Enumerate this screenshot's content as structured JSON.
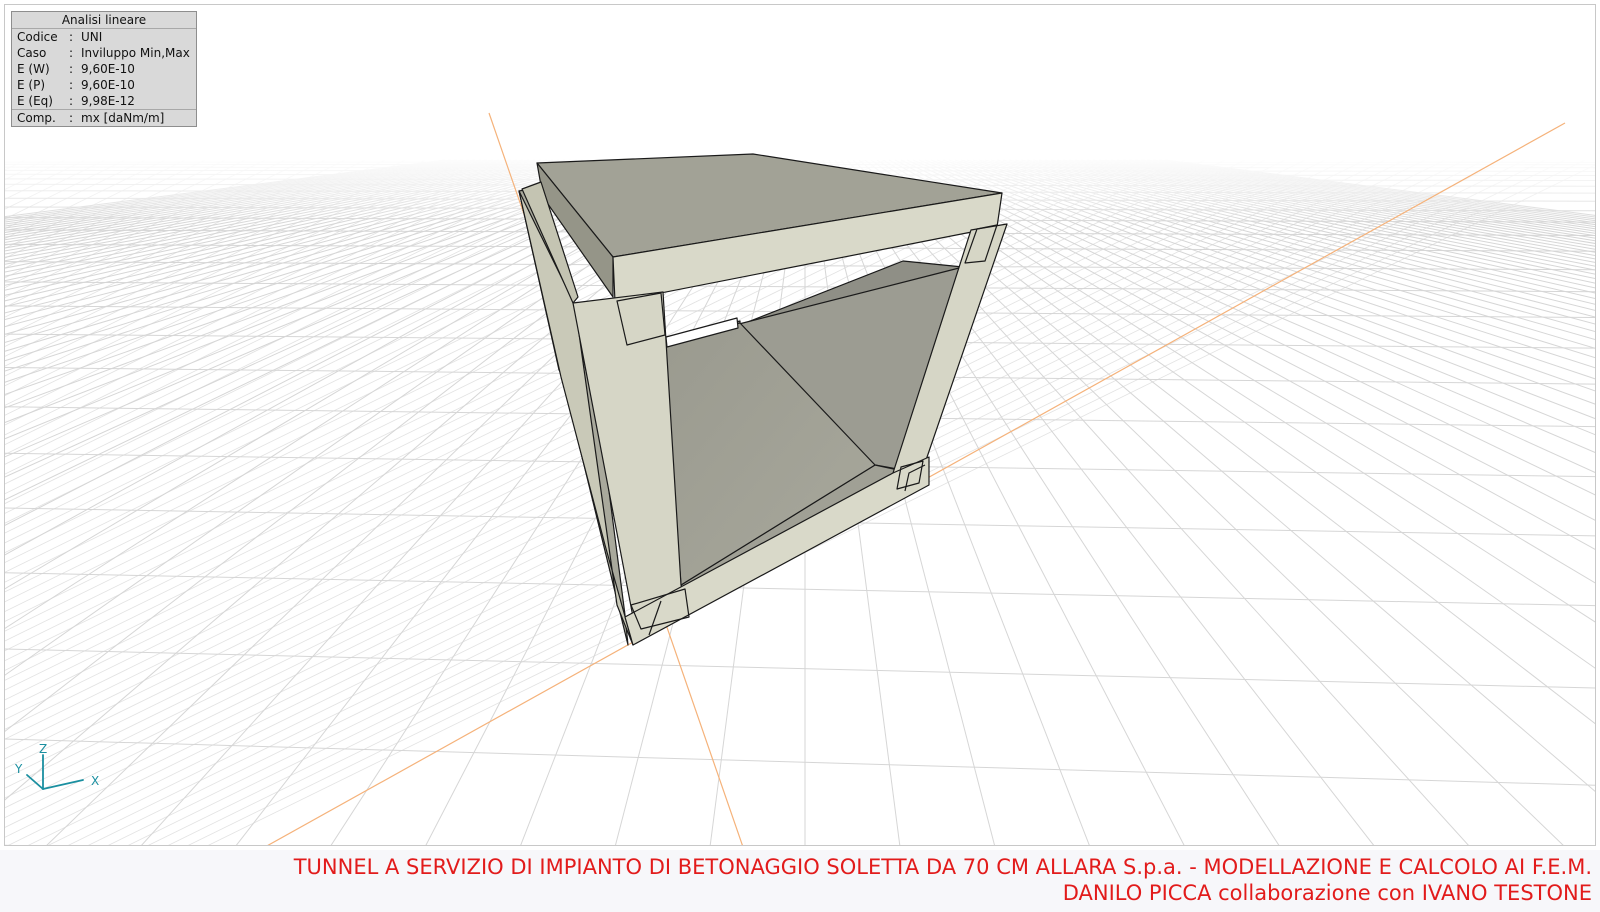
{
  "info_panel": {
    "title": "Analisi lineare",
    "rows": [
      {
        "key": "Codice",
        "value": "UNI"
      },
      {
        "key": "Caso",
        "value": "Inviluppo Min,Max"
      },
      {
        "key": "E (W)",
        "value": "9,60E-10"
      },
      {
        "key": "E (P)",
        "value": "9,60E-10"
      },
      {
        "key": "E (Eq)",
        "value": "9,98E-12"
      },
      {
        "key": "Comp.",
        "value": "mx [daNm/m]"
      }
    ]
  },
  "axes": {
    "z": "Z",
    "y": "Y",
    "x": "X"
  },
  "footer": {
    "line1": "TUNNEL A SERVIZIO DI IMPIANTO DI BETONAGGIO SOLETTA DA 70 CM ALLARA S.p.a. - MODELLAZIONE E CALCOLO AI F.E.M.",
    "line2": "DANILO PICCA collaborazione con IVANO TESTONE"
  },
  "colors": {
    "footer_text": "#e21b1b",
    "axis_triad": "#1a8fa0",
    "reference_axis": "#f5b27a",
    "grid": "#d6d6d6",
    "model_face_light": "#d8d8c8",
    "model_face_mid": "#a3a397",
    "model_face_dark": "#8e8e84"
  }
}
